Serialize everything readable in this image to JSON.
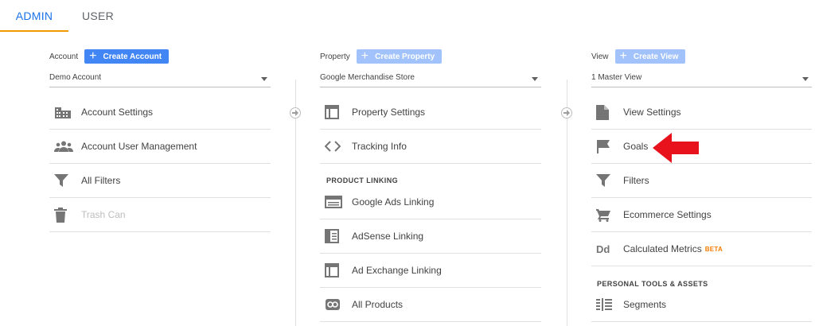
{
  "tabs": {
    "admin": "ADMIN",
    "user": "USER"
  },
  "account": {
    "label": "Account",
    "create_label": "Create Account",
    "selected": "Demo Account",
    "items": [
      {
        "label": "Account Settings",
        "icon": "building-icon"
      },
      {
        "label": "Account User Management",
        "icon": "people-icon"
      },
      {
        "label": "All Filters",
        "icon": "filter-icon"
      },
      {
        "label": "Trash Can",
        "icon": "trash-icon",
        "disabled": true
      }
    ]
  },
  "property": {
    "label": "Property",
    "create_label": "Create Property",
    "selected": "Google Merchandise Store",
    "items": [
      {
        "label": "Property Settings",
        "icon": "window-icon"
      },
      {
        "label": "Tracking Info",
        "icon": "code-icon"
      }
    ],
    "section_title": "PRODUCT LINKING",
    "linking_items": [
      {
        "label": "Google Ads Linking",
        "icon": "ads-icon"
      },
      {
        "label": "AdSense Linking",
        "icon": "adsense-icon"
      },
      {
        "label": "Ad Exchange Linking",
        "icon": "window-icon"
      },
      {
        "label": "All Products",
        "icon": "link-icon"
      }
    ]
  },
  "view": {
    "label": "View",
    "create_label": "Create View",
    "selected": "1 Master View",
    "items": [
      {
        "label": "View Settings",
        "icon": "document-icon"
      },
      {
        "label": "Goals",
        "icon": "flag-icon"
      },
      {
        "label": "Filters",
        "icon": "filter-icon"
      },
      {
        "label": "Ecommerce Settings",
        "icon": "cart-icon"
      },
      {
        "label": "Calculated Metrics",
        "icon": "dd-icon",
        "badge": "BETA"
      }
    ],
    "section_title": "PERSONAL TOOLS & ASSETS",
    "tools_items": [
      {
        "label": "Segments",
        "icon": "segments-icon"
      }
    ]
  },
  "colors": {
    "accent_blue": "#1a73e8",
    "tab_underline": "#f29900",
    "button_blue": "#4285f4",
    "button_disabled": "#a1c2fa",
    "annotation_red": "#e8121c",
    "beta_orange": "#f57c00"
  }
}
